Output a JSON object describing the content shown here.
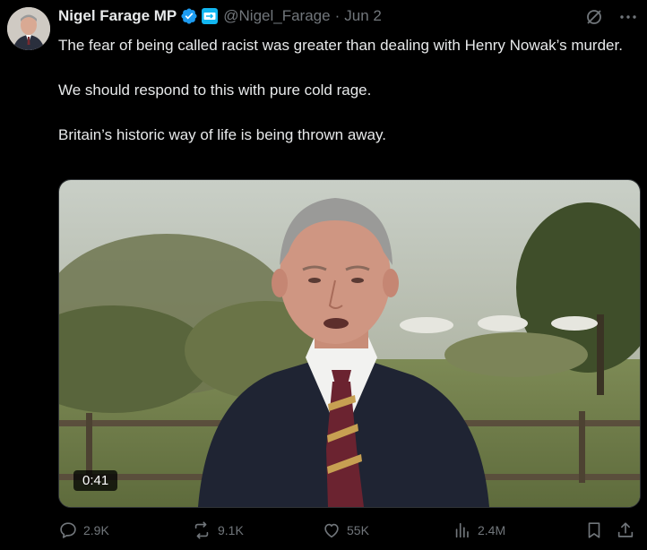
{
  "tweet": {
    "author_name": "Nigel Farage MP",
    "handle": "@Nigel_Farage",
    "separator": "·",
    "date": "Jun 2",
    "paragraphs": [
      "The fear of being called racist was greater than dealing with Henry Nowak’s murder.",
      "We should respond to this with pure cold rage.",
      "Britain’s historic way of life is being thrown away."
    ],
    "video_duration": "0:41"
  },
  "actions": {
    "replies": "2.9K",
    "reposts": "9.1K",
    "likes": "55K",
    "views": "2.4M"
  },
  "icons": {
    "verified": "verified-badge-icon",
    "affiliation": "affiliation-badge-icon",
    "grok": "grok-icon",
    "more": "more-icon",
    "reply": "reply-icon",
    "repost": "repost-icon",
    "like": "heart-icon",
    "views": "views-icon",
    "bookmark": "bookmark-icon",
    "share": "share-icon"
  },
  "colors": {
    "background": "#000000",
    "text_primary": "#e7e9ea",
    "text_secondary": "#71767b",
    "verified": "#1d9bf0",
    "affiliation": "#12b6f0"
  }
}
